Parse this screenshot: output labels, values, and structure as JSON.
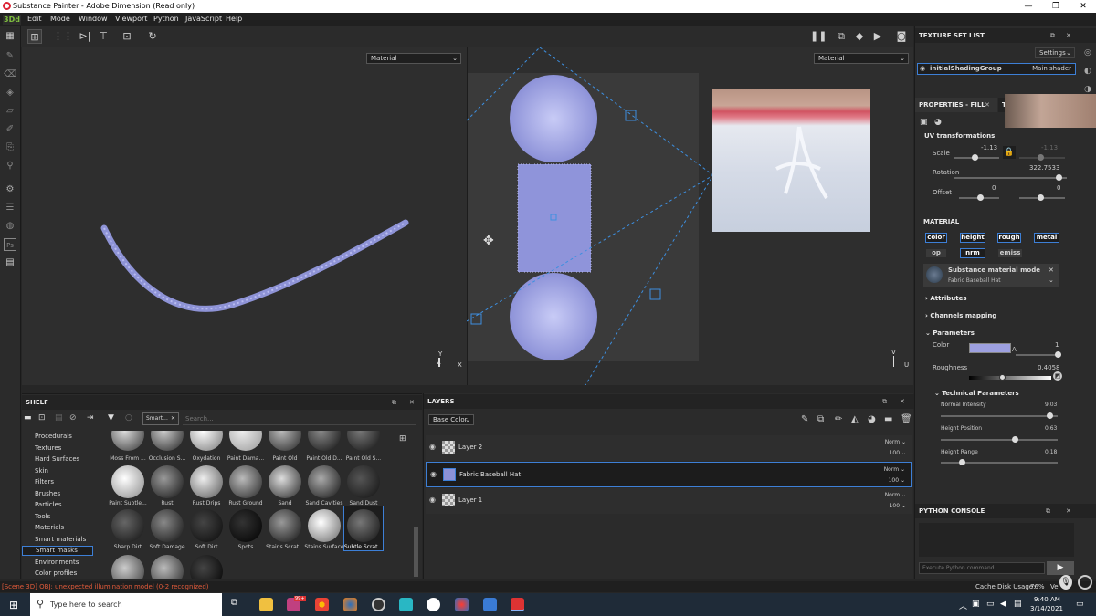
{
  "window": {
    "title": "Substance Painter - Adobe Dimension (Read only)",
    "min": "—",
    "max": "❐",
    "close": "✕"
  },
  "menu": {
    "app": "3Dd",
    "items": [
      "Edit",
      "Mode",
      "Window",
      "Viewport",
      "Python",
      "JavaScript",
      "Help"
    ]
  },
  "viewport": {
    "left_mode": "Material",
    "right_mode": "Material",
    "axis_y": "Y",
    "axis_z": "Z",
    "axis_x": "X",
    "axis_v": "V",
    "axis_u": "U"
  },
  "texture_set": {
    "header": "TEXTURE SET LIST",
    "settings": "Settings",
    "group": "initialShadingGroup",
    "shader": "Main shader"
  },
  "properties": {
    "header": "PROPERTIES - FILL",
    "tab2": "TE",
    "uv_header": "UV transformations",
    "scale_label": "Scale",
    "scale_a": "-1.13",
    "scale_b": "-1.13",
    "rotation_label": "Rotation",
    "rotation_value": "322.7533",
    "offset_label": "Offset",
    "offset_a": "0",
    "offset_b": "0",
    "material_header": "MATERIAL",
    "channels": [
      "color",
      "height",
      "rough",
      "metal",
      "op",
      "nrm",
      "emiss"
    ],
    "substance_mode": "Substance material mode",
    "substance_name": "Fabric Baseball Hat",
    "attributes": "Attributes",
    "channels_mapping": "Channels mapping",
    "parameters": "Parameters",
    "color_label": "Color",
    "color_a": "A",
    "color_value": "1",
    "color_swatch": "#9da0e0",
    "roughness_label": "Roughness",
    "roughness_value": "0.4058",
    "roughness_fraction": 0.4058,
    "tech_header": "Technical Parameters",
    "normal_label": "Normal Intensity",
    "normal_value": "9.03",
    "height_pos_label": "Height Position",
    "height_pos_value": "0.63",
    "height_range_label": "Height Range",
    "height_range_value": "0.18"
  },
  "python": {
    "header": "PYTHON CONSOLE",
    "placeholder": "Execute Python command..."
  },
  "shelf": {
    "header": "SHELF",
    "filter": "Smart...",
    "search_placeholder": "Search...",
    "categories": [
      "Procedurals",
      "Textures",
      "Hard Surfaces",
      "Skin",
      "Filters",
      "Brushes",
      "Particles",
      "Tools",
      "Materials",
      "Smart materials",
      "Smart masks",
      "Environments",
      "Color profiles"
    ],
    "selected_category": "Smart masks",
    "row1": [
      "Moss From ...",
      "Occlusion S...",
      "Oxydation",
      "Paint Dama...",
      "Paint Old",
      "Paint Old D...",
      "Paint Old S..."
    ],
    "row2": [
      "Paint Subtle...",
      "Rust",
      "Rust Drips",
      "Rust Ground",
      "Sand",
      "Sand Cavities",
      "Sand Dust"
    ],
    "row3": [
      "Sharp Dirt",
      "Soft Damage",
      "Soft Dirt",
      "Spots",
      "Stains Scrat...",
      "Stains Surface",
      "Subtle Scrat..."
    ]
  },
  "layers": {
    "header": "LAYERS",
    "channel": "Base Color",
    "rows": [
      {
        "name": "Layer 2",
        "blend": "Norm",
        "opacity": "100"
      },
      {
        "name": "Fabric Baseball Hat",
        "blend": "Norm",
        "opacity": "100"
      },
      {
        "name": "Layer 1",
        "blend": "Norm",
        "opacity": "100"
      }
    ]
  },
  "status": {
    "error": "[Scene 3D] OBJ: unexpected illumination model (0-2 recognized)",
    "cache": "Cache Disk Usage:",
    "cache_value": "76%",
    "version": "Ve"
  },
  "taskbar": {
    "search": "Type here to search",
    "time": "9:40 AM",
    "date": "3/14/2021",
    "badge": "99+"
  }
}
